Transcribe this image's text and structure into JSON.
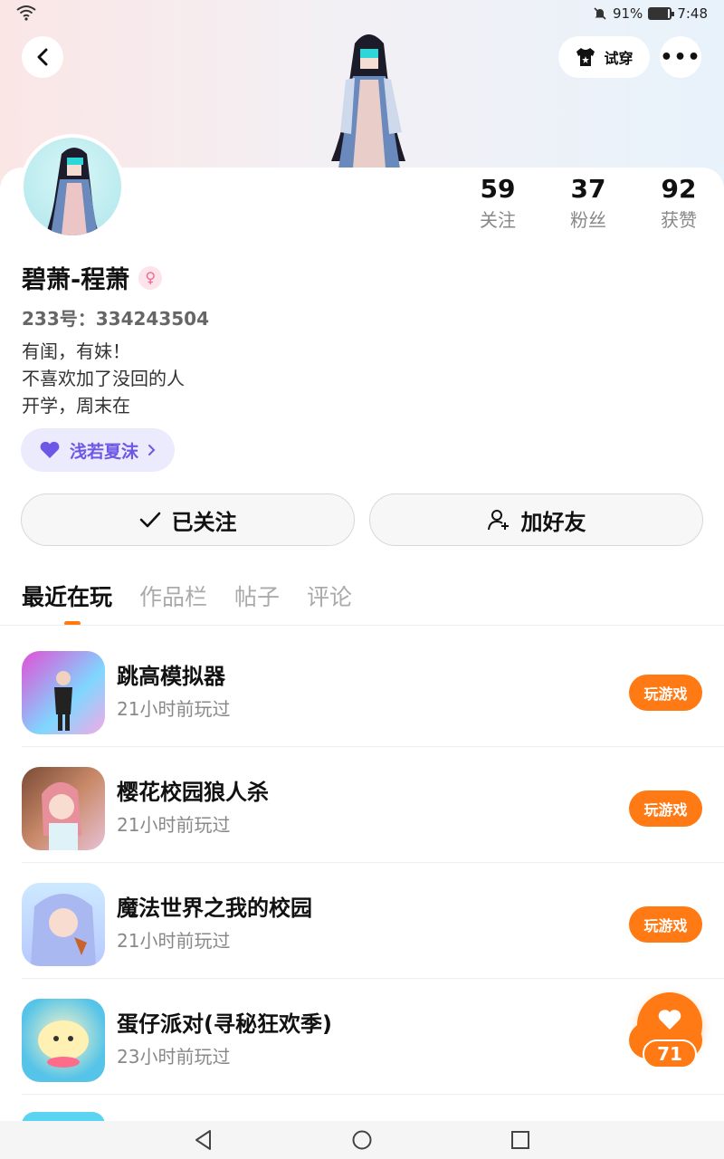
{
  "status_bar": {
    "battery": "91%",
    "time": "7:48",
    "battery_level": 0.91
  },
  "header": {
    "tryon_label": "试穿"
  },
  "profile": {
    "nickname": "碧萧-程萧",
    "gender_symbol": "♀",
    "uid_text": "233号：334243504",
    "bio": [
      "有闺，有妹！",
      "不喜欢加了没回的人",
      "开学，周末在"
    ],
    "intimacy_label": "浅若夏沫",
    "stats": [
      {
        "num": "59",
        "label": "关注"
      },
      {
        "num": "37",
        "label": "粉丝"
      },
      {
        "num": "92",
        "label": "获赞"
      }
    ]
  },
  "actions": {
    "follow_label": "已关注",
    "add_friend_label": "加好友"
  },
  "tabs": [
    "最近在玩",
    "作品栏",
    "帖子",
    "评论"
  ],
  "games": [
    {
      "name": "跳高模拟器",
      "time": "21小时前玩过",
      "play_label": "玩游戏"
    },
    {
      "name": "樱花校园狼人杀",
      "time": "21小时前玩过",
      "play_label": "玩游戏"
    },
    {
      "name": "魔法世界之我的校园",
      "time": "21小时前玩过",
      "play_label": "玩游戏"
    },
    {
      "name": "蛋仔派对(寻秘狂欢季)",
      "time": "23小时前玩过",
      "play_label": "玩游戏"
    }
  ],
  "like_fab": {
    "count": "71"
  },
  "colors": {
    "accent": "#ff7a14",
    "intimacy": "#6c57e6"
  }
}
